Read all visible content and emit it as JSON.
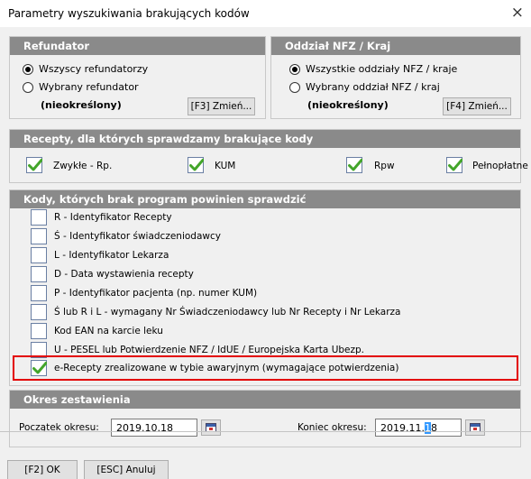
{
  "window": {
    "title": "Parametry wyszukiwania brakujących kodów",
    "close": "×"
  },
  "refundator": {
    "header": "Refundator",
    "opt_all": "Wszyscy refundatorzy",
    "opt_selected": "Wybrany refundator",
    "value": "(nieokreślony)",
    "change_button": "[F3] Zmień..."
  },
  "oddzial": {
    "header": "Oddział NFZ / Kraj",
    "opt_all": "Wszystkie oddziały NFZ / kraje",
    "opt_selected": "Wybrany oddział NFZ / kraj",
    "value": "(nieokreślony)",
    "change_button": "[F4] Zmień..."
  },
  "recepty": {
    "header": "Recepty, dla których sprawdzamy brakujące kody",
    "items": [
      {
        "label": "Zwykłe - Rp.",
        "checked": true
      },
      {
        "label": "KUM",
        "checked": true
      },
      {
        "label": "Rpw",
        "checked": true
      },
      {
        "label": "Pełnopłatne",
        "checked": true
      }
    ]
  },
  "kody": {
    "header": "Kody, których brak program powinien sprawdzić",
    "items": [
      {
        "label": "R - Identyfikator Recepty",
        "checked": false
      },
      {
        "label": "Ś - Identyfikator świadczeniodawcy",
        "checked": false
      },
      {
        "label": "L - Identyfikator Lekarza",
        "checked": false
      },
      {
        "label": "D - Data wystawienia recepty",
        "checked": false
      },
      {
        "label": "P - Identyfikator pacjenta (np. numer KUM)",
        "checked": false
      },
      {
        "label": "Ś lub R i L - wymagany Nr Świadczeniodawcy lub Nr Recepty i Nr Lekarza",
        "checked": false
      },
      {
        "label": "Kod EAN na karcie leku",
        "checked": false
      },
      {
        "label": "U - PESEL lub Potwierdzenie NFZ / IdUE / Europejska Karta Ubezp.",
        "checked": false
      },
      {
        "label": "e-Recepty zrealizowane w tybie awaryjnym (wymagające potwierdzenia)",
        "checked": true
      }
    ]
  },
  "okres": {
    "header": "Okres zestawienia",
    "start_label": "Początek okresu:",
    "start_value": "2019.10.18",
    "end_label": "Koniec okresu:",
    "end_value_prefix": "2019.11.",
    "end_value_selected": "1",
    "end_value_suffix": "8"
  },
  "footer": {
    "ok_button": "[F2] OK",
    "cancel_button": "[ESC] Anuluj"
  },
  "colors": {
    "group_header": "#8a8a8a",
    "highlight": "#e30000",
    "check": "#43a52a",
    "selection": "#3399ff"
  }
}
